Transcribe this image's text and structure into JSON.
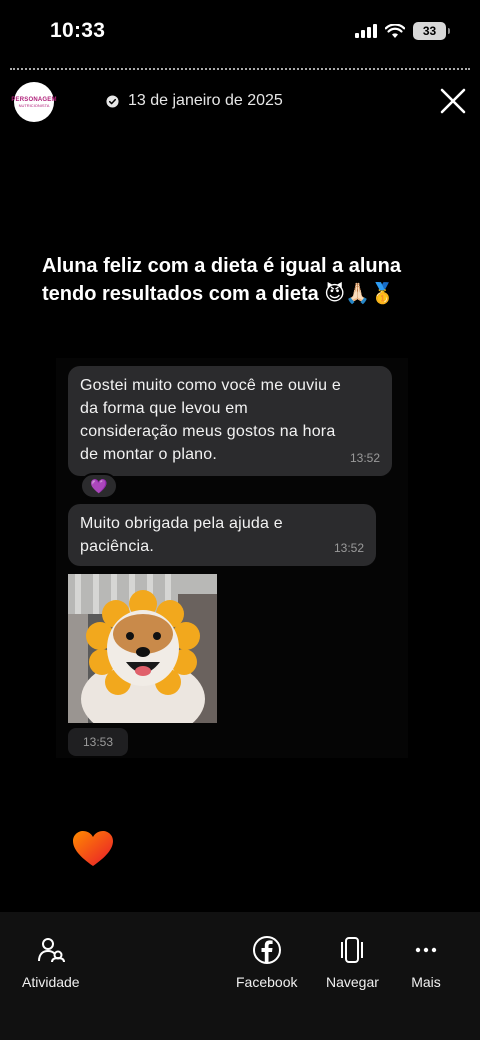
{
  "status_bar": {
    "time": "10:33",
    "battery": "33",
    "icons": [
      "cellular-signal-icon",
      "wifi-icon",
      "battery-icon"
    ]
  },
  "story": {
    "account_logo_text": "PERSONAGEM",
    "account_logo_subtext": "NUTRICIONISTA",
    "date": "13 de janeiro de 2025",
    "caption": "Aluna feliz com a dieta é igual a aluna tendo resultados com a dieta 😈🙏🏻🥇",
    "messages": [
      {
        "text": "Gostei muito como você me ouviu e\nda forma que levou em\nconsideração meus gostos na hora\nde montar o plano.",
        "time": "13:52",
        "reaction": "💜"
      },
      {
        "text": "Muito obrigada pela ajuda e\npaciência.",
        "time": "13:52"
      }
    ],
    "photo_time": "13:53",
    "sticker": "heart-sticker"
  },
  "bottom_nav": {
    "activity": "Atividade",
    "facebook": "Facebook",
    "browse": "Navegar",
    "more": "Mais"
  },
  "colors": {
    "background": "#000000",
    "bubble": "#2b2b2d",
    "bottom_bar": "#111111"
  }
}
